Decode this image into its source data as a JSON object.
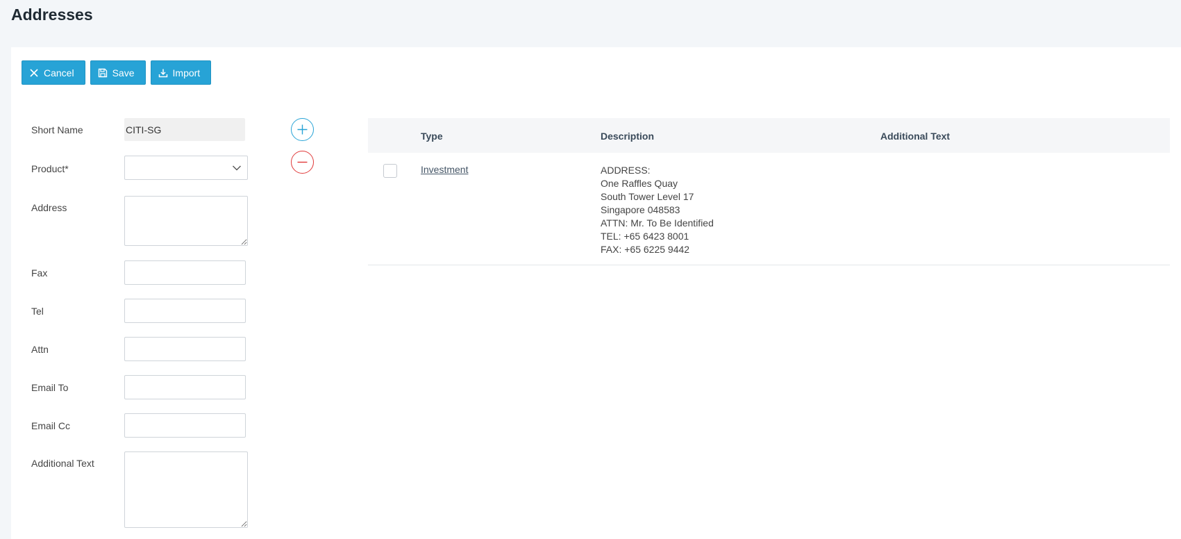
{
  "page": {
    "title": "Addresses"
  },
  "toolbar": {
    "cancel_label": "Cancel",
    "save_label": "Save",
    "import_label": "Import"
  },
  "form": {
    "short_name_label": "Short Name",
    "short_name_value": "CITI-SG",
    "product_label": "Product*",
    "product_value": "",
    "address_label": "Address",
    "fax_label": "Fax",
    "tel_label": "Tel",
    "attn_label": "Attn",
    "email_to_label": "Email To",
    "email_cc_label": "Email Cc",
    "additional_text_label": "Additional Text"
  },
  "grid": {
    "columns": {
      "type": "Type",
      "description": "Description",
      "additional_text": "Additional Text"
    },
    "rows": [
      {
        "type": "Investment",
        "description_lines": [
          "ADDRESS:",
          "One Raffles Quay",
          "South Tower Level 17",
          "Singapore 048583",
          "ATTN: Mr. To Be Identified",
          "TEL: +65 6423 8001",
          "FAX: +65 6225 9442"
        ],
        "additional_text": ""
      }
    ]
  },
  "colors": {
    "accent": "#27a3d6",
    "danger": "#e03a3a"
  },
  "icons": {
    "cancel": "close-icon",
    "save": "save-icon",
    "import": "download-icon",
    "add": "plus-icon",
    "remove": "minus-icon",
    "dropdown": "chevron-down-icon"
  }
}
